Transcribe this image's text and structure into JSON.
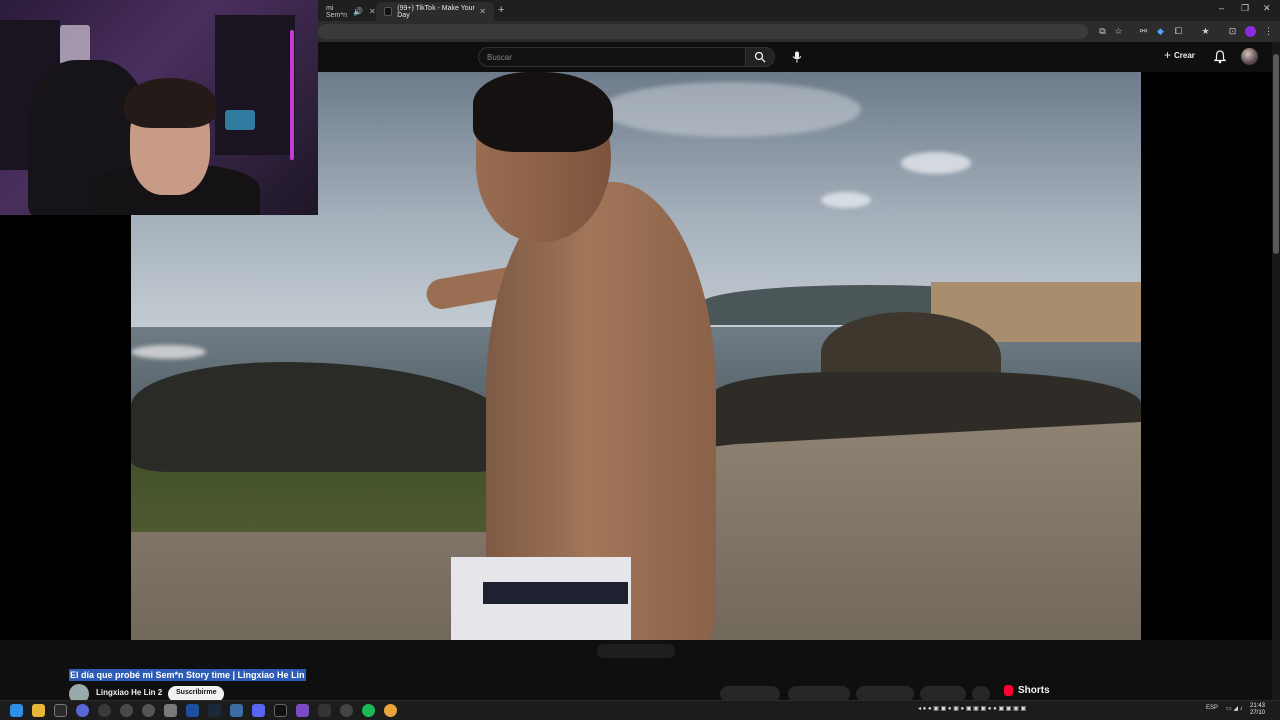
{
  "browser": {
    "tabs": [
      {
        "label": "mi Sem*n",
        "active": false
      },
      {
        "label": "(99+) TikTok - Make Your Day",
        "active": true
      }
    ],
    "new_tab": "+",
    "window_controls": [
      "–",
      "❐",
      "✕"
    ]
  },
  "youtube": {
    "search_placeholder": "Buscar",
    "create_label": "Crear",
    "video": {
      "title": "El día que probé mi Sem*n Story time | Lingxiao He Lin",
      "channel": "Lingxiao He Lin 2",
      "subscribe_label": "Suscribirme"
    },
    "shorts_label": "Shorts"
  },
  "taskbar": {
    "language": "ESP",
    "time": "21:43",
    "date": "27/10"
  },
  "colors": {
    "accent_red": "#ff0033",
    "title_highlight": "#2d5bb5"
  }
}
